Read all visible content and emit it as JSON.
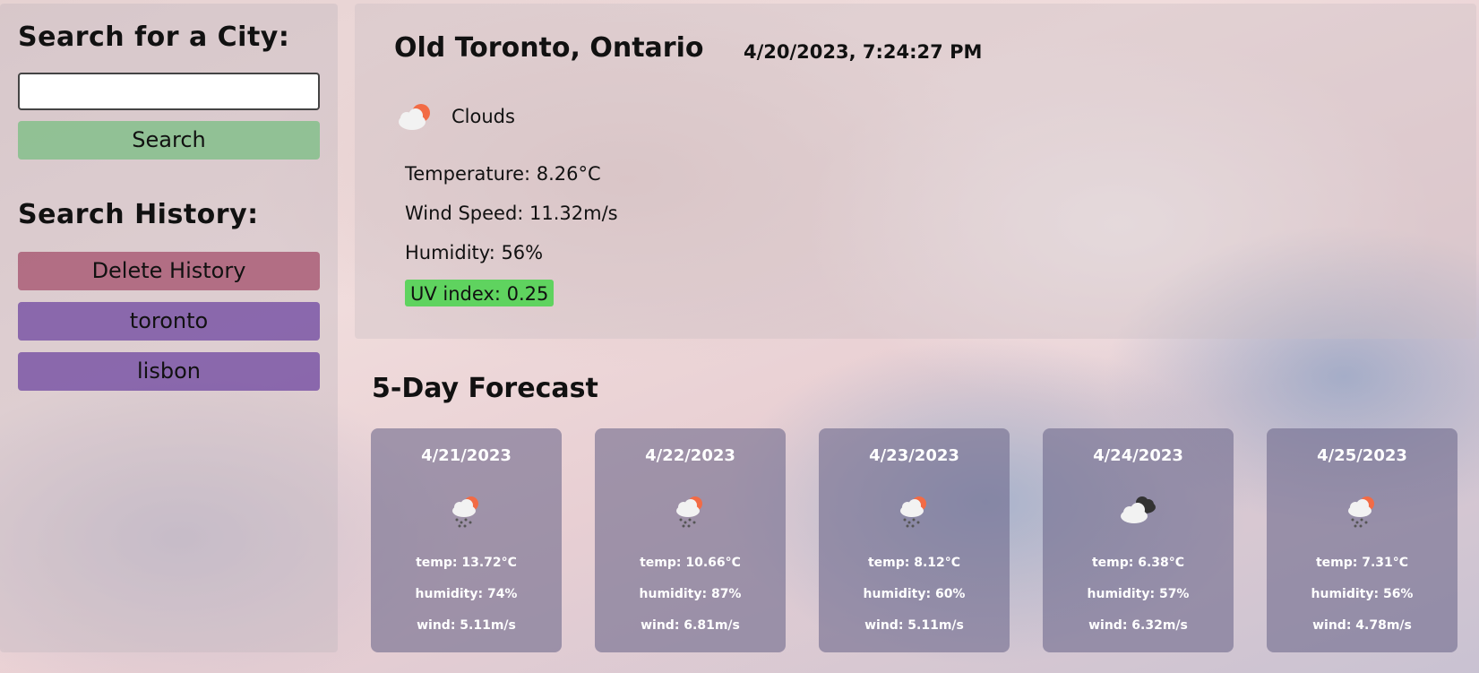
{
  "sidebar": {
    "search_title": "Search for a City:",
    "search_input_value": "",
    "search_button": "Search",
    "history_title": "Search History:",
    "delete_button": "Delete History",
    "history": [
      "toronto",
      "lisbon"
    ]
  },
  "current": {
    "city": "Old Toronto, Ontario",
    "datetime": "4/20/2023, 7:24:27 PM",
    "condition": "Clouds",
    "condition_icon": "partly-cloudy-icon",
    "temperature": "Temperature: 8.26°C",
    "wind": "Wind Speed: 11.32m/s",
    "humidity": "Humidity: 56%",
    "uv": "UV index: 0.25",
    "uv_color": "#5fd35f"
  },
  "forecast": {
    "title": "5-Day Forecast",
    "days": [
      {
        "date": "4/21/2023",
        "icon": "rain-sun-icon",
        "temp": "temp: 13.72°C",
        "humidity": "humidity: 74%",
        "wind": "wind: 5.11m/s"
      },
      {
        "date": "4/22/2023",
        "icon": "rain-sun-icon",
        "temp": "temp: 10.66°C",
        "humidity": "humidity: 87%",
        "wind": "wind: 6.81m/s"
      },
      {
        "date": "4/23/2023",
        "icon": "rain-sun-icon",
        "temp": "temp: 8.12°C",
        "humidity": "humidity: 60%",
        "wind": "wind: 5.11m/s"
      },
      {
        "date": "4/24/2023",
        "icon": "broken-clouds-icon",
        "temp": "temp: 6.38°C",
        "humidity": "humidity: 57%",
        "wind": "wind: 6.32m/s"
      },
      {
        "date": "4/25/2023",
        "icon": "rain-sun-icon",
        "temp": "temp: 7.31°C",
        "humidity": "humidity: 56%",
        "wind": "wind: 4.78m/s"
      }
    ]
  }
}
